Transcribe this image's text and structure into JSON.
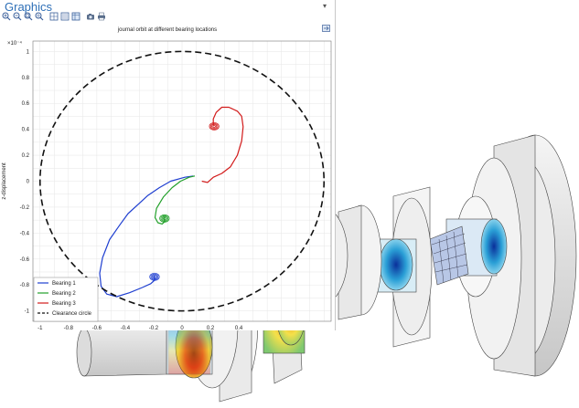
{
  "panel": {
    "title": "Graphics",
    "menu_glyph": "▾"
  },
  "toolbar": {
    "buttons": [
      {
        "name": "zoom-in-icon"
      },
      {
        "name": "zoom-out-icon"
      },
      {
        "name": "zoom-box-icon"
      },
      {
        "name": "zoom-extents-icon"
      },
      {
        "name": "grid-view-icon"
      },
      {
        "name": "list-view-icon"
      },
      {
        "name": "table-view-icon"
      },
      {
        "name": "camera-icon"
      },
      {
        "name": "print-icon"
      }
    ]
  },
  "export_icon": "export-icon",
  "chart_data": {
    "type": "line",
    "title": "journal orbit at different bearing locations",
    "xlabel": "",
    "ylabel": "z-displacement",
    "y_multiplier": "×10⁻⁴",
    "xlim": [
      -1.05,
      1.05
    ],
    "ylim": [
      -1.08,
      1.08
    ],
    "x_ticks": [
      -1,
      -0.8,
      -0.6,
      -0.4,
      -0.2,
      0,
      0.2,
      0.4
    ],
    "y_ticks": [
      1,
      0.8,
      0.6,
      0.4,
      0.2,
      0,
      -0.2,
      -0.4,
      -0.6,
      -0.8,
      -1
    ],
    "grid": true,
    "legend_placement": "bottom-left",
    "series": [
      {
        "name": "Bearing 1",
        "color": "#1f3fd0",
        "x": [
          0.08,
          0.02,
          -0.08,
          -0.16,
          -0.24,
          -0.3,
          -0.38,
          -0.44,
          -0.51,
          -0.56,
          -0.58,
          -0.57,
          -0.53,
          -0.46,
          -0.37,
          -0.28,
          -0.22,
          -0.19,
          -0.2
        ],
        "y": [
          0.04,
          0.03,
          0.0,
          -0.05,
          -0.11,
          -0.17,
          -0.25,
          -0.34,
          -0.45,
          -0.59,
          -0.71,
          -0.81,
          -0.87,
          -0.89,
          -0.86,
          -0.82,
          -0.79,
          -0.76,
          -0.73
        ]
      },
      {
        "name": "Bearing 2",
        "color": "#22a02a",
        "x": [
          0.09,
          0.05,
          -0.01,
          -0.07,
          -0.13,
          -0.18,
          -0.19,
          -0.17,
          -0.14,
          -0.12,
          -0.13
        ],
        "y": [
          0.04,
          0.03,
          0.0,
          -0.05,
          -0.12,
          -0.21,
          -0.28,
          -0.32,
          -0.33,
          -0.31,
          -0.28
        ]
      },
      {
        "name": "Bearing 3",
        "color": "#d21a1a",
        "x": [
          0.14,
          0.18,
          0.22,
          0.28,
          0.34,
          0.39,
          0.42,
          0.43,
          0.42,
          0.39,
          0.33,
          0.28,
          0.24,
          0.22,
          0.22
        ],
        "y": [
          0.0,
          -0.01,
          0.03,
          0.06,
          0.11,
          0.2,
          0.31,
          0.42,
          0.5,
          0.54,
          0.57,
          0.57,
          0.53,
          0.48,
          0.43
        ]
      },
      {
        "name": "Clearance circle",
        "color": "#111111",
        "style": "dashed",
        "center": [
          0,
          0
        ],
        "radius": 1.0
      }
    ]
  }
}
